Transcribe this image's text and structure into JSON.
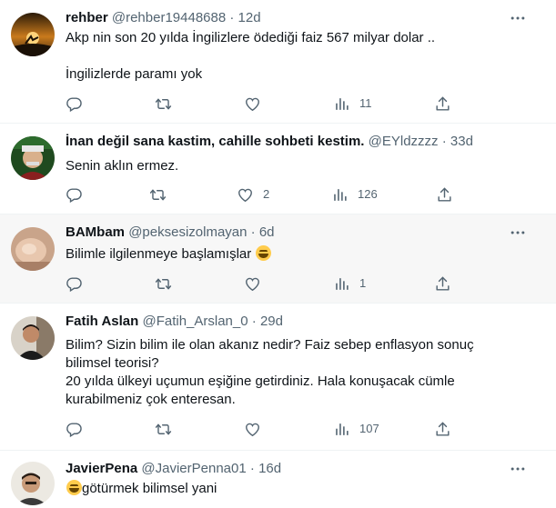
{
  "tweets": [
    {
      "name": "rehber",
      "handle": "@rehber19448688",
      "dot": "·",
      "time": "12d",
      "lines": [
        "Akp nin son 20 yılda İngilizlere ödediği faiz 567 milyar dolar ..",
        "",
        "İngilizlerde paramı yok"
      ],
      "replies": "",
      "retweets": "",
      "likes": "",
      "views": "11"
    },
    {
      "name": "İnan değil sana kastim, cahille sohbeti kestim.",
      "handle": "@EYldzzzz",
      "dot": "·",
      "time": "33d",
      "lines": [
        "Senin aklın ermez."
      ],
      "replies": "",
      "retweets": "",
      "likes": "2",
      "views": "126"
    },
    {
      "name": "BAMbam",
      "handle": "@peksesizolmayan",
      "dot": "·",
      "time": "6d",
      "lines": [
        "Bilimle ilgilenmeye başlamışlar"
      ],
      "replies": "",
      "retweets": "",
      "likes": "",
      "views": "1"
    },
    {
      "name": "Fatih Aslan",
      "handle": "@Fatih_Arslan_0",
      "dot": "·",
      "time": "29d",
      "lines": [
        "Bilim? Sizin bilim ile olan akanız nedir? Faiz sebep enflasyon sonuç",
        "bilimsel teorisi?",
        "20 yılda ülkeyi uçumun eşiğine getirdiniz. Hala konuşacak cümle",
        "kurabilmeniz çok enteresan."
      ],
      "replies": "",
      "retweets": "",
      "likes": "",
      "views": "107"
    },
    {
      "name": "JavierPena",
      "handle": "@JavierPenna01",
      "dot": "·",
      "time": "16d",
      "lines": [
        "götürmek bilimsel yani"
      ],
      "replies": "",
      "retweets": "",
      "likes": "",
      "views": ""
    }
  ],
  "icons": {
    "reply": "reply-icon",
    "retweet": "retweet-icon",
    "like": "heart-icon",
    "views": "views-icon",
    "share": "share-icon",
    "more": "more-icon"
  },
  "colors": {
    "text": "#0f1419",
    "muted": "#536471",
    "divider": "#eff3f4",
    "hover_bg": "#f7f7f7"
  }
}
